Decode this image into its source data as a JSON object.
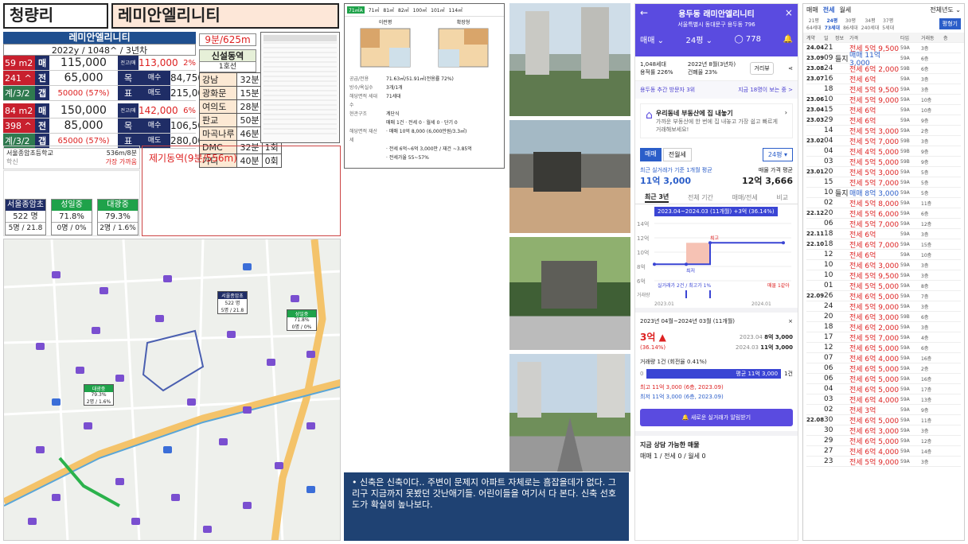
{
  "header": {
    "region": "청량리",
    "complex": "레미안엘리니티"
  },
  "info": {
    "title": "레미안엘리니티",
    "subtitle": "2022y / 1048^ / 3년차",
    "rows": [
      {
        "c1": "59 m2",
        "c2": "매",
        "c3": "115,000",
        "c4": "전고(매매)",
        "c5": "113,000",
        "c6": "2%"
      },
      {
        "c1": "241 ^",
        "c2": "전",
        "c3": "65,000",
        "c4": "목",
        "c5": "매수",
        "c6": "84,750"
      },
      {
        "c1": "계/3/2",
        "c2": "갭",
        "c3": "50000 (57%)",
        "c4": "표",
        "c5": "매도",
        "c6": "215,000"
      },
      {
        "c1": "84 m2",
        "c2": "매",
        "c3": "150,000",
        "c4": "전고(매매)",
        "c5": "142,000",
        "c6": "6%"
      },
      {
        "c1": "398 ^",
        "c2": "전",
        "c3": "85,000",
        "c4": "목",
        "c5": "매수",
        "c6": "106,500"
      },
      {
        "c1": "계/3/2",
        "c2": "갭",
        "c3": "65000 (57%)",
        "c4": "표",
        "c5": "매도",
        "c6": "280,000"
      }
    ]
  },
  "walk": "9분/625m",
  "station": {
    "title": "신설동역",
    "sub": "1호선",
    "rows": [
      [
        "강남",
        "32분",
        "2회"
      ],
      [
        "광화문",
        "15분",
        "1회"
      ],
      [
        "여의도",
        "28분",
        "1회"
      ],
      [
        "판교",
        "50분",
        "2회"
      ],
      [
        "마곡나루",
        "46분",
        "1회"
      ],
      [
        "DMC",
        "32분",
        "1회"
      ],
      [
        "가디",
        "40분",
        "0회"
      ]
    ]
  },
  "school_line": {
    "name": "서울종암초등학교",
    "dist": "536m/8분",
    "sub": "학신",
    "sub2": "가장 가까움"
  },
  "station2": "제기동역(9분/556m)",
  "schools": [
    {
      "name": "서울종암초",
      "v1": "522 명",
      "v2": "5명 / 21.8"
    },
    {
      "name": "성일중",
      "v1": "71.8%",
      "v2": "0명 / 0%"
    },
    {
      "name": "대광중",
      "v1": "79.3%",
      "v2": "2명 / 1.6%"
    }
  ],
  "map_labels": [
    {
      "a": "서울종암초",
      "b": "522 명",
      "c": "5명 / 21.8"
    },
    {
      "a": "성일중",
      "b": "71.8%",
      "c": "0명 / 0%"
    },
    {
      "a": "대광중",
      "b": "79.3%",
      "c": "2명 / 1.6%"
    }
  ],
  "floorplan": {
    "tabs": [
      "71㎡A",
      "71㎡",
      "81㎡",
      "82㎡",
      "100㎡",
      "101㎡",
      "114㎡"
    ],
    "plan1": "이런평",
    "plan2": "확장형",
    "specs": [
      {
        "k": "공급/전용",
        "v": "71.63㎡/51.91㎡(전용률 72%)"
      },
      {
        "k": "방수/욕실수",
        "v": "3개/1개"
      },
      {
        "k": "해당면적 세대수",
        "v": "71세대"
      },
      {
        "k": "현관구조",
        "v": "계단식"
      },
      {
        "k": "",
        "v": "매매 1건 · 전세 0 · 월세 0 · 단기 0"
      },
      {
        "k": "해당면적 재산세",
        "v": "· 매매 10억 8,000 (6,000만원/3.3㎡)"
      },
      {
        "k": "",
        "v": "· 전세 6억~6억 3,000만 / 재건 ~3.85억"
      },
      {
        "k": "",
        "v": "· 전세가율 55~57%"
      }
    ]
  },
  "note": "신축은 신축이다.. 주변이 문제지 아파트 자체로는 흠잡을데가 없다. 그리구 지금까지 못봤던 갓난애기들. 어린이들을 여기서 다 본다. 신축 선호도가 확실히 높나보다.",
  "phone": {
    "title": "용두동 래미안엘리니티",
    "address": "서울특별시 동대문구 용두동 796",
    "trade": "매매",
    "size": "24평",
    "comments": "778",
    "stat1": "1,048세대",
    "stat2": "2022년 8월(3년차)",
    "stat3": "용적률 226%",
    "stat4": "건폐율 23%",
    "dist_btn": "거리뷰",
    "rank": "용두동 추간 방문자 3위",
    "rank_link": "지금 18명이 보는 중 >",
    "ad_title": "우리동네 부동산에 집 내놓기",
    "ad_sub": "가까운 부동산에 한 번에 집 내놓고 가장 쉽고 빠르게 거래해보세요!",
    "tab1": "매매",
    "tab2": "전월세",
    "size2": "24평",
    "recent": "최근 실거래가 기준 1개월 평균",
    "recent_val": "11억 3,000",
    "sell": "매물 가격 평균",
    "sell_val": "12억 3,666",
    "ptabs": [
      "최근 3년",
      "전체 기간",
      "매매/전세",
      "비교"
    ],
    "chart_band": "2023.04~2024.03 (11개월) +3억 (36.14%)",
    "yt": [
      "14억",
      "12억",
      "10억",
      "8억",
      "6억"
    ],
    "xt": [
      "2023.01",
      "2024.01"
    ],
    "vol": "거래량",
    "leg1": "실거래가 2건 / 최고가 1%",
    "leg2": "매물 1같아",
    "min": "최저",
    "max": "최고",
    "period": "2023년 04월~2024년 03월 (11개월)",
    "delta": "3억",
    "deltap": "(36.14%)",
    "from_d": "2023.04",
    "from_v": "8억 3,000",
    "to_d": "2024.03",
    "to_v": "11억 3,000",
    "volume": "거래량 1건 (회전율 0.41%)",
    "bar_label": "평균 11억 3,000",
    "bar_n": "1건",
    "hi": "최고 11억 3,000 (6층, 2023.09)",
    "lo": "최저 11억 3,000 (6층, 2023.09)",
    "alert": "새로운 실거래가 알림받기",
    "avail": "지금 상담 가능한 매물",
    "avail_val": "매매 1 / 전세 0 / 월세 0"
  },
  "chart_data": {
    "type": "line",
    "x": [
      "2023.01",
      "2023.04",
      "2023.09",
      "2024.03"
    ],
    "series": [
      {
        "values": [
          8.3,
          8.3,
          11.3,
          11.3
        ]
      }
    ],
    "ylim": [
      6,
      14
    ]
  },
  "tx": {
    "tabs": [
      "매매",
      "전세",
      "월세"
    ],
    "dd": "전체년도",
    "years": [
      [
        "21평",
        "64세대"
      ],
      [
        "24평",
        "73세대"
      ],
      [
        "30평",
        "86세대"
      ],
      [
        "34평",
        "240세대"
      ],
      [
        "37평",
        "5세대"
      ]
    ],
    "btn": "평형기",
    "h": [
      "계약",
      "일",
      "정보",
      "가격",
      "타입",
      "거래동",
      "층"
    ],
    "rows": [
      [
        "24.04",
        "21",
        "",
        "전세 5억 9,500",
        "59A",
        "3층",
        "r"
      ],
      [
        "23.09",
        "09",
        "들지",
        "매매 11억 3,000",
        "59A",
        "6층",
        "b"
      ],
      [
        "23.08",
        "24",
        "",
        "전세 6억 2,000",
        "59B",
        "6층",
        "r"
      ],
      [
        "23.07",
        "16",
        "",
        "전세 6억",
        "59A",
        "3층",
        "r"
      ],
      [
        "",
        "18",
        "",
        "전세 5억 9,500",
        "59A",
        "3층",
        "r"
      ],
      [
        "23.06",
        "10",
        "",
        "전세 5억 9,000",
        "59A",
        "10층",
        "r"
      ],
      [
        "23.04",
        "15",
        "",
        "전세 6억",
        "59A",
        "10층",
        "r"
      ],
      [
        "23.03",
        "29",
        "",
        "전세 6억",
        "59A",
        "9층",
        "r"
      ],
      [
        "",
        "14",
        "",
        "전세 5억 3,000",
        "59A",
        "2층",
        "r"
      ],
      [
        "23.02",
        "04",
        "",
        "전세 5억 7,000",
        "59B",
        "3층",
        "r"
      ],
      [
        "",
        "04",
        "",
        "전세 4억 5,000",
        "59B",
        "9층",
        "r"
      ],
      [
        "",
        "03",
        "",
        "전세 5억 5,000",
        "59B",
        "9층",
        "r"
      ],
      [
        "23.01",
        "20",
        "",
        "전세 5억 3,000",
        "59A",
        "5층",
        "r"
      ],
      [
        "",
        "15",
        "",
        "전세 5억 7,000",
        "59A",
        "5층",
        "r"
      ],
      [
        "",
        "10",
        "들지",
        "매매 8억 3,000",
        "59A",
        "5층",
        "b"
      ],
      [
        "",
        "02",
        "",
        "전세 5억 8,000",
        "59A",
        "11층",
        "r"
      ],
      [
        "22.12",
        "20",
        "",
        "전세 5억 6,000",
        "59A",
        "6층",
        "r"
      ],
      [
        "",
        "06",
        "",
        "전세 5억 7,000",
        "59A",
        "12층",
        "r"
      ],
      [
        "22.11",
        "18",
        "",
        "전세 6억",
        "59A",
        "3층",
        "r"
      ],
      [
        "22.10",
        "18",
        "",
        "전세 6억 7,000",
        "59A",
        "15층",
        "r"
      ],
      [
        "",
        "12",
        "",
        "전세 6억",
        "59A",
        "10층",
        "r"
      ],
      [
        "",
        "10",
        "",
        "전세 6억 3,000",
        "59A",
        "3층",
        "r"
      ],
      [
        "",
        "10",
        "",
        "전세 5억 9,500",
        "59A",
        "3층",
        "r"
      ],
      [
        "",
        "01",
        "",
        "전세 5억 5,000",
        "59A",
        "8층",
        "r"
      ],
      [
        "22.09",
        "26",
        "",
        "전세 6억 5,000",
        "59A",
        "7층",
        "r"
      ],
      [
        "",
        "24",
        "",
        "전세 5억 9,000",
        "59A",
        "3층",
        "r"
      ],
      [
        "",
        "20",
        "",
        "전세 6억 3,000",
        "59B",
        "6층",
        "r"
      ],
      [
        "",
        "18",
        "",
        "전세 6억 2,000",
        "59A",
        "3층",
        "r"
      ],
      [
        "",
        "17",
        "",
        "전세 5억 7,000",
        "59A",
        "4층",
        "r"
      ],
      [
        "",
        "12",
        "",
        "전세 6억 5,000",
        "59A",
        "6층",
        "r"
      ],
      [
        "",
        "07",
        "",
        "전세 6억 4,000",
        "59A",
        "16층",
        "r"
      ],
      [
        "",
        "06",
        "",
        "전세 6억 5,000",
        "59A",
        "2층",
        "r"
      ],
      [
        "",
        "06",
        "",
        "전세 6억 5,000",
        "59A",
        "16층",
        "r"
      ],
      [
        "",
        "04",
        "",
        "전세 6억 5,000",
        "59A",
        "17층",
        "r"
      ],
      [
        "",
        "03",
        "",
        "전세 6억 4,000",
        "59A",
        "13층",
        "r"
      ],
      [
        "",
        "02",
        "",
        "전세 3억",
        "59A",
        "9층",
        "r"
      ],
      [
        "22.08",
        "30",
        "",
        "전세 6억 5,000",
        "59A",
        "11층",
        "r"
      ],
      [
        "",
        "30",
        "",
        "전세 6억 3,000",
        "59A",
        "3층",
        "r"
      ],
      [
        "",
        "29",
        "",
        "전세 6억 5,000",
        "59A",
        "12층",
        "r"
      ],
      [
        "",
        "27",
        "",
        "전세 6억 4,000",
        "59A",
        "14층",
        "r"
      ],
      [
        "",
        "23",
        "",
        "전세 5억 9,000",
        "59A",
        "3층",
        "r"
      ]
    ]
  }
}
